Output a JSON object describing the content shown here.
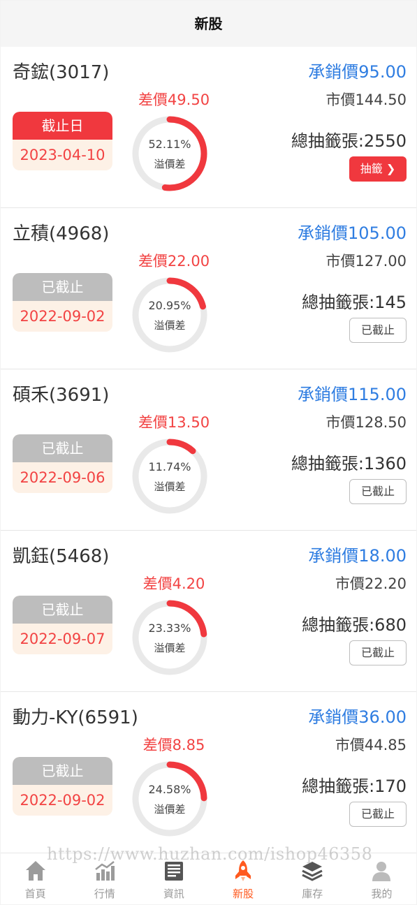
{
  "header": {
    "title": "新股"
  },
  "stocks": [
    {
      "name": "奇鋐(3017)",
      "underwriting": "承銷價95.00",
      "market": "市價144.50",
      "diff": "差價49.50",
      "pct_text": "52.11%",
      "pct": 52.11,
      "ring_label": "溢價差",
      "date_status": "截止日",
      "date": "2023-04-10",
      "lots": "總抽籤張:2550",
      "button": "抽籤 ❯",
      "active": true
    },
    {
      "name": "立積(4968)",
      "underwriting": "承銷價105.00",
      "market": "市價127.00",
      "diff": "差價22.00",
      "pct_text": "20.95%",
      "pct": 20.95,
      "ring_label": "溢價差",
      "date_status": "已截止",
      "date": "2022-09-02",
      "lots": "總抽籤張:145",
      "button": "已截止",
      "active": false
    },
    {
      "name": "碩禾(3691)",
      "underwriting": "承銷價115.00",
      "market": "市價128.50",
      "diff": "差價13.50",
      "pct_text": "11.74%",
      "pct": 11.74,
      "ring_label": "溢價差",
      "date_status": "已截止",
      "date": "2022-09-06",
      "lots": "總抽籤張:1360",
      "button": "已截止",
      "active": false
    },
    {
      "name": "凱鈺(5468)",
      "underwriting": "承銷價18.00",
      "market": "市價22.20",
      "diff": "差價4.20",
      "pct_text": "23.33%",
      "pct": 23.33,
      "ring_label": "溢價差",
      "date_status": "已截止",
      "date": "2022-09-07",
      "lots": "總抽籤張:680",
      "button": "已截止",
      "active": false
    },
    {
      "name": "動力-KY(6591)",
      "underwriting": "承銷價36.00",
      "market": "市價44.85",
      "diff": "差價8.85",
      "pct_text": "24.58%",
      "pct": 24.58,
      "ring_label": "溢價差",
      "date_status": "已截止",
      "date": "2022-09-02",
      "lots": "總抽籤張:170",
      "button": "已截止",
      "active": false
    }
  ],
  "tabs": [
    {
      "label": "首頁",
      "icon": "home-icon",
      "active": false
    },
    {
      "label": "行情",
      "icon": "chart-icon",
      "active": false
    },
    {
      "label": "資訊",
      "icon": "news-icon",
      "active": false
    },
    {
      "label": "新股",
      "icon": "rocket-icon",
      "active": true
    },
    {
      "label": "庫存",
      "icon": "layers-icon",
      "active": false
    },
    {
      "label": "我的",
      "icon": "user-icon",
      "active": false
    }
  ],
  "watermark": "https://www.huzhan.com/ishop46358",
  "colors": {
    "red": "#f0383e",
    "blue": "#2f7de1",
    "gray": "#bdbdbd",
    "ring_track": "#e9e9e9",
    "tab_active": "#ff5a1f",
    "tab_inactive": "#9b9b9b"
  }
}
